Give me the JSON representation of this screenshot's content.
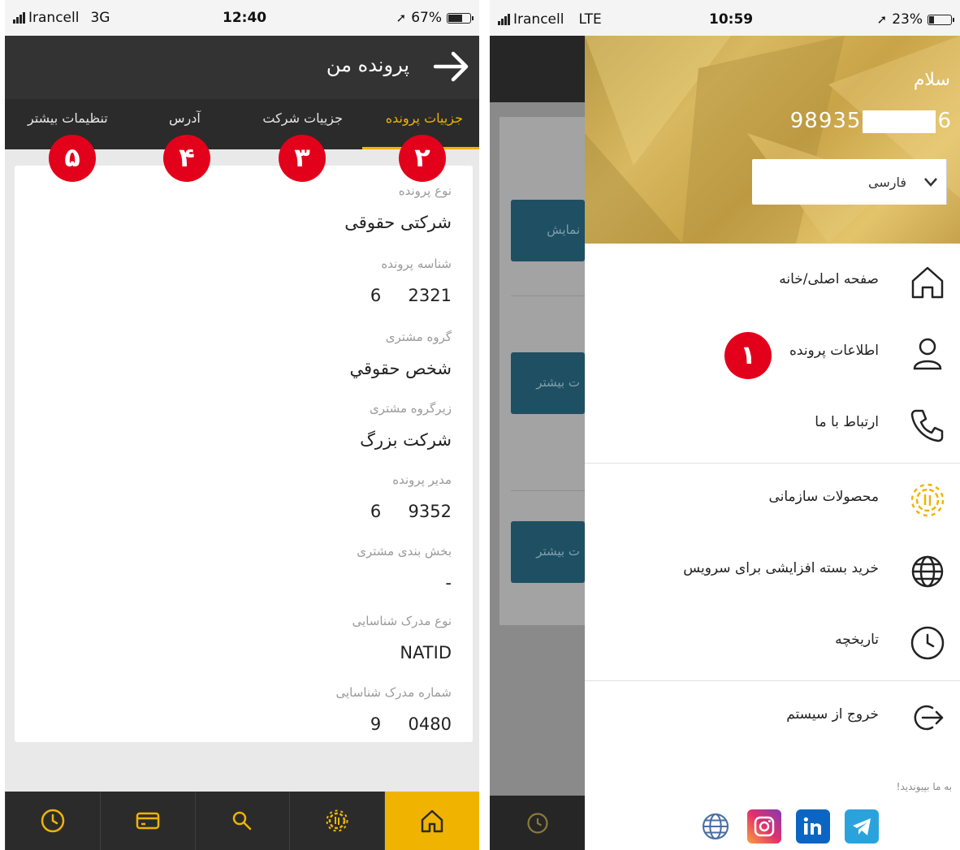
{
  "left": {
    "status": {
      "carrier": "Irancell",
      "network": "3G",
      "time": "12:40",
      "battery": "67%",
      "battery_level": 0.67
    },
    "title": "پرونده من",
    "tabs": [
      "جزییات پرونده",
      "جزییات شرکت",
      "آدرس",
      "تنظیمات بیشتر"
    ],
    "active_tab": 0,
    "badges": [
      "۲",
      "۳",
      "۴",
      "۵"
    ],
    "fields": [
      {
        "label": "نوع پرونده",
        "value": "شرکتی حقوقی"
      },
      {
        "label": "شناسه پرونده",
        "value": "6     2321"
      },
      {
        "label": "گروه مشتری",
        "value": "شخص حقوقي"
      },
      {
        "label": "زیرگروه مشتری",
        "value": "شرکت بزرگ"
      },
      {
        "label": "مدیر پرونده",
        "value": "6     9352"
      },
      {
        "label": "بخش بندی مشتری",
        "value": "-"
      },
      {
        "label": "نوع مدرک شناسایی",
        "value": "NATID"
      },
      {
        "label": "شماره مدرک شناسایی",
        "value": "9     0480"
      }
    ],
    "bottom_nav": [
      "clock-icon",
      "card-icon",
      "search-icon",
      "gear-icon",
      "home-icon"
    ],
    "accent": "#f0b400"
  },
  "right": {
    "status": {
      "carrier": "Irancell",
      "network": "LTE",
      "time": "10:59",
      "battery": "23%",
      "battery_level": 0.23
    },
    "greeting": "سلام",
    "phone_prefix": "98935",
    "phone_suffix": "6",
    "language": "فارسی",
    "dim_buttons": [
      "نمایش",
      "ت بیشتر",
      "ت بیشتر"
    ],
    "menu": [
      {
        "label": "صفحه اصلی/خانه",
        "icon": "home-icon"
      },
      {
        "label": "اطلاعات پرونده",
        "icon": "user-icon"
      },
      {
        "label": "ارتباط با ما",
        "icon": "phone-icon"
      },
      {
        "label": "محصولات سازمانی",
        "icon": "gear-icon"
      },
      {
        "label": "خرید بسته افزایشی برای سرویس",
        "icon": "globe-icon"
      },
      {
        "label": "تاریخچه",
        "icon": "clock-icon"
      },
      {
        "label": "خروج از سیستم",
        "icon": "logout-icon"
      }
    ],
    "badge": "۱",
    "join_text": "به ما بپیوندید!",
    "socials": [
      "globe-icon",
      "instagram-icon",
      "linkedin-icon",
      "telegram-icon"
    ]
  }
}
